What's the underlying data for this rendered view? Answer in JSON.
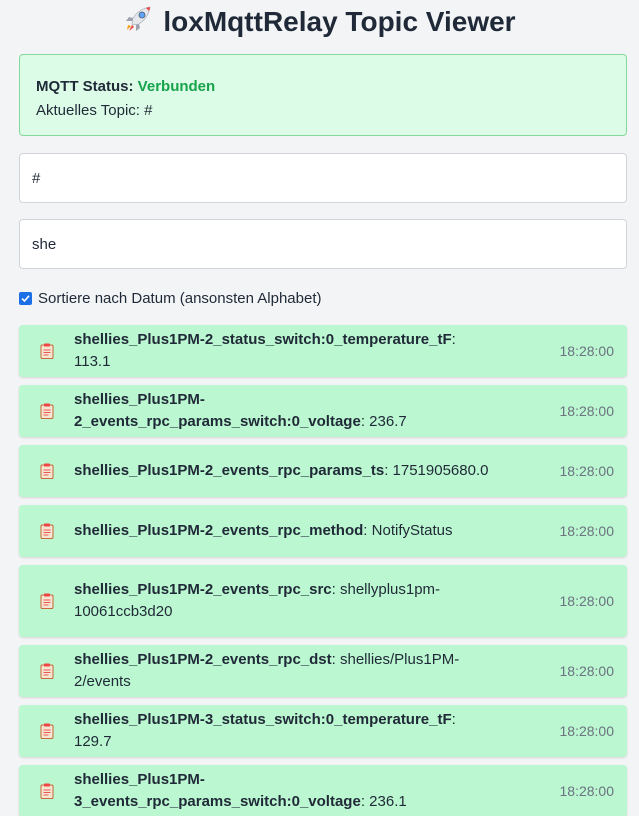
{
  "header": {
    "title": "loxMqttRelay Topic Viewer",
    "icon": "rocket-icon"
  },
  "status": {
    "label": "MQTT Status:",
    "value": "Verbunden",
    "topic_label": "Aktuelles Topic:",
    "topic_value": "#"
  },
  "inputs": {
    "topic_value": "#",
    "filter_value": "she"
  },
  "sort": {
    "checked": true,
    "label": "Sortiere nach Datum (ansonsten Alphabet)"
  },
  "messages": [
    {
      "key": "shellies_Plus1PM-2_status_switch:0_temperature_tF",
      "value": "113.1",
      "time": "18:28:00"
    },
    {
      "key": "shellies_Plus1PM-2_events_rpc_params_switch:0_voltage",
      "value": "236.7",
      "time": "18:28:00"
    },
    {
      "key": "shellies_Plus1PM-2_events_rpc_params_ts",
      "value": "1751905680.0",
      "time": "18:28:00"
    },
    {
      "key": "shellies_Plus1PM-2_events_rpc_method",
      "value": "NotifyStatus",
      "time": "18:28:00"
    },
    {
      "key": "shellies_Plus1PM-2_events_rpc_src",
      "value": "shellyplus1pm-10061ccb3d20",
      "time": "18:28:00"
    },
    {
      "key": "shellies_Plus1PM-2_events_rpc_dst",
      "value": "shellies/Plus1PM-2/events",
      "time": "18:28:00"
    },
    {
      "key": "shellies_Plus1PM-3_status_switch:0_temperature_tF",
      "value": "129.7",
      "time": "18:28:00"
    },
    {
      "key": "shellies_Plus1PM-3_events_rpc_params_switch:0_voltage",
      "value": "236.1",
      "time": "18:28:00"
    }
  ],
  "colors": {
    "status_ok": "#16a34a",
    "status_bg": "#dcfce7",
    "message_bg": "#bbf7d0",
    "checkbox": "#1d6fe8"
  }
}
